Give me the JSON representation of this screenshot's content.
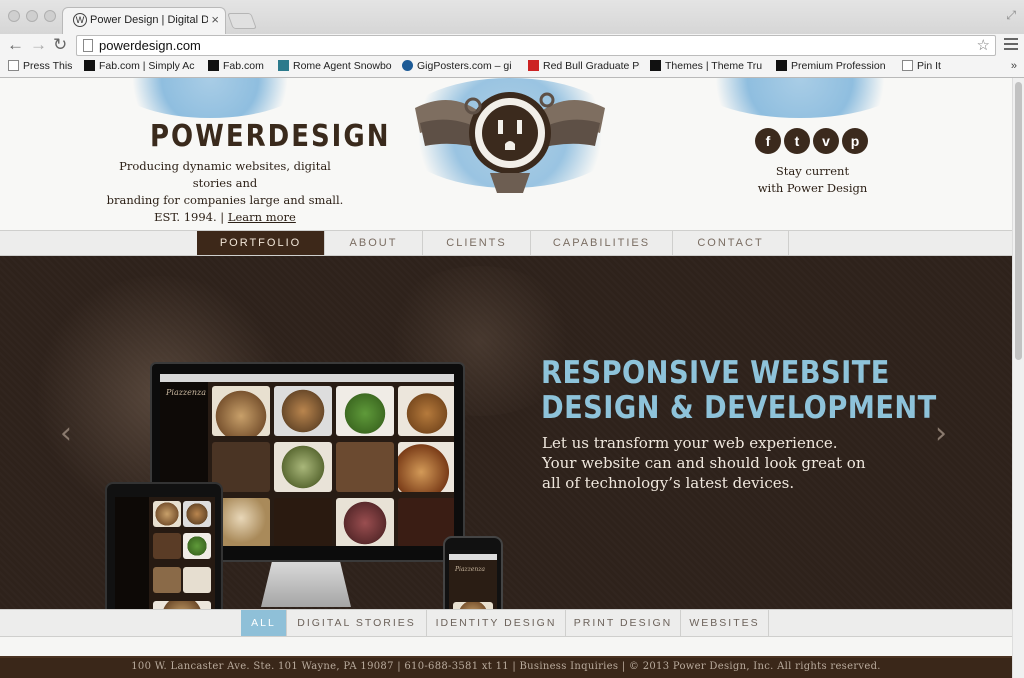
{
  "browser": {
    "tab_title": "Power Design | Digital Des",
    "tab_favicon": "W",
    "url": "powerdesign.com",
    "bookmarks": [
      {
        "label": "Press This",
        "icon": "page"
      },
      {
        "label": "Fab.com | Simply Ac",
        "icon": "dark"
      },
      {
        "label": "Fab.com",
        "icon": "dark"
      },
      {
        "label": "Rome Agent Snowbo",
        "icon": "teal"
      },
      {
        "label": "GigPosters.com – gi",
        "icon": "blue"
      },
      {
        "label": "Red Bull Graduate Pr",
        "icon": "red"
      },
      {
        "label": "Themes | Theme Tru",
        "icon": "dark"
      },
      {
        "label": "Premium Profession",
        "icon": "dark"
      },
      {
        "label": "Pin It",
        "icon": "page"
      }
    ],
    "bookmark_overflow": "»"
  },
  "header": {
    "logo": "POWERDESIGN",
    "tagline_line1": "Producing dynamic websites, digital stories and",
    "tagline_line2": "branding for companies large and small.",
    "est": "EST. 1994. |",
    "learn_more": "Learn more",
    "social": [
      {
        "name": "facebook",
        "glyph": "f"
      },
      {
        "name": "twitter",
        "glyph": "t"
      },
      {
        "name": "vimeo",
        "glyph": "v"
      },
      {
        "name": "pinterest",
        "glyph": "p"
      }
    ],
    "stay_line1": "Stay current",
    "stay_line2": "with Power Design"
  },
  "nav": {
    "items": [
      "PORTFOLIO",
      "ABOUT",
      "CLIENTS",
      "CAPABILITIES",
      "CONTACT"
    ],
    "active": "PORTFOLIO"
  },
  "hero": {
    "headline_line1": "RESPONSIVE WEBSITE",
    "headline_line2": "DESIGN & DEVELOPMENT",
    "body": "Let us transform your web experience. Your website can and should look great  on all of technology’s latest devices.",
    "prev_arrow": "‹",
    "next_arrow": "›",
    "screen_brand": "Piazzenza"
  },
  "filters": {
    "items": [
      "ALL",
      "DIGITAL STORIES",
      "IDENTITY DESIGN",
      "PRINT DESIGN",
      "WEBSITES"
    ],
    "active": "ALL"
  },
  "footer": {
    "text": "100 W. Lancaster Ave. Ste. 101 Wayne, PA 19087 | 610-688-3581 xt 11 | Business Inquiries | © 2013 Power Design, Inc. All rights reserved."
  },
  "colors": {
    "brand_brown": "#3d2819",
    "accent_blue": "#8ec3da",
    "hero_bg": "#2e221b"
  }
}
